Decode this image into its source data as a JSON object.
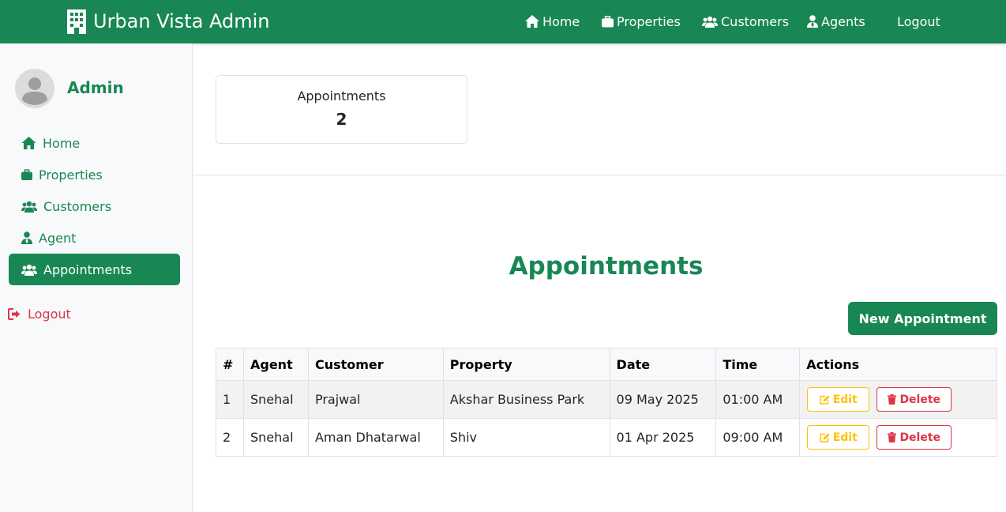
{
  "navbar": {
    "brand": "Urban Vista Admin",
    "links": [
      {
        "label": "Home",
        "icon": "home-icon"
      },
      {
        "label": "Properties",
        "icon": "briefcase-icon"
      },
      {
        "label": "Customers",
        "icon": "users-icon"
      },
      {
        "label": "Agents",
        "icon": "user-tie-icon"
      },
      {
        "label": "Logout"
      }
    ]
  },
  "sidebar": {
    "user": "Admin",
    "items": [
      {
        "label": "Home",
        "icon": "home-icon"
      },
      {
        "label": "Properties",
        "icon": "briefcase-icon"
      },
      {
        "label": "Customers",
        "icon": "users-icon"
      },
      {
        "label": "Agent",
        "icon": "user-tie-icon"
      },
      {
        "label": "Appointments",
        "icon": "users-icon",
        "active": true
      }
    ],
    "logout": "Logout"
  },
  "stat": {
    "label": "Appointments",
    "value": "2"
  },
  "main": {
    "title": "Appointments",
    "new_button": "New Appointment"
  },
  "table": {
    "headers": [
      "#",
      "Agent",
      "Customer",
      "Property",
      "Date",
      "Time",
      "Actions"
    ],
    "rows": [
      {
        "num": "1",
        "agent": "Snehal",
        "customer": "Prajwal",
        "property": "Akshar Business Park",
        "date": "09 May 2025",
        "time": "01:00 AM"
      },
      {
        "num": "2",
        "agent": "Snehal",
        "customer": "Aman Dhatarwal",
        "property": "Shiv",
        "date": "01 Apr 2025",
        "time": "09:00 AM"
      }
    ],
    "edit_label": "Edit",
    "delete_label": "Delete"
  },
  "colors": {
    "primary": "#198754",
    "danger": "#dc3545",
    "warning": "#ffc107"
  }
}
